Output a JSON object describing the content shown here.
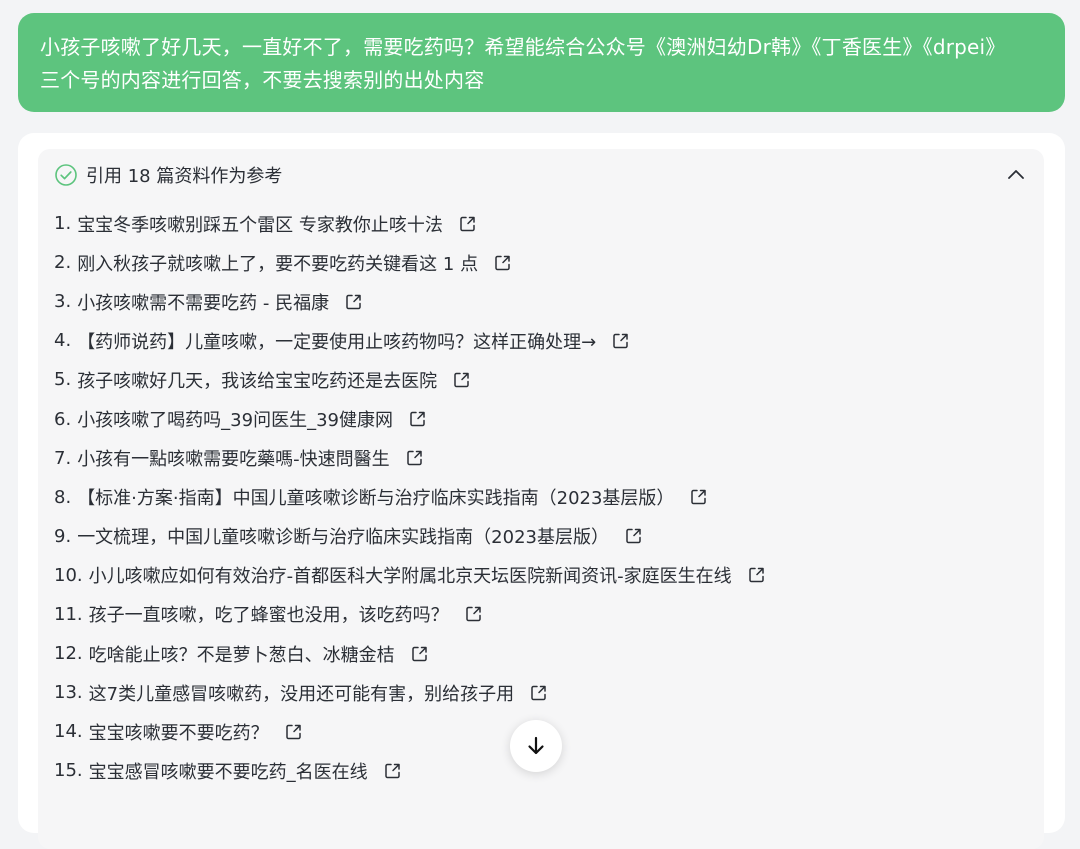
{
  "user_message": {
    "line1": "小孩子咳嗽了好几天，一直好不了，需要吃药吗？希望能综合公众号《澳洲妇幼Dr韩》《丁香医生》《drpei》",
    "line2": "三个号的内容进行回答，不要去搜索别的出处内容"
  },
  "references": {
    "title": "引用 18 篇资料作为参考",
    "check_icon": "check-circle-icon",
    "collapse_icon": "chevron-up-icon",
    "link_icon": "external-link-icon",
    "items": [
      {
        "num": "1.",
        "title": "宝宝冬季咳嗽别踩五个雷区 专家教你止咳十法"
      },
      {
        "num": "2.",
        "title": "刚入秋孩子就咳嗽上了，要不要吃药关键看这 1 点"
      },
      {
        "num": "3.",
        "title": "小孩咳嗽需不需要吃药 - 民福康"
      },
      {
        "num": "4.",
        "title": "【药师说药】儿童咳嗽，一定要使用止咳药物吗？这样正确处理→"
      },
      {
        "num": "5.",
        "title": "孩子咳嗽好几天，我该给宝宝吃药还是去医院"
      },
      {
        "num": "6.",
        "title": "小孩咳嗽了喝药吗_39问医生_39健康网"
      },
      {
        "num": "7.",
        "title": "小孩有一點咳嗽需要吃藥嗎-快速問醫生"
      },
      {
        "num": "8.",
        "title": "【标准·方案·指南】中国儿童咳嗽诊断与治疗临床实践指南（2023基层版）"
      },
      {
        "num": "9.",
        "title": "一文梳理，中国儿童咳嗽诊断与治疗临床实践指南（2023基层版）"
      },
      {
        "num": "10.",
        "title": "小儿咳嗽应如何有效治疗-首都医科大学附属北京天坛医院新闻资讯-家庭医生在线"
      },
      {
        "num": "11.",
        "title": "孩子一直咳嗽，吃了蜂蜜也没用，该吃药吗？"
      },
      {
        "num": "12.",
        "title": "吃啥能止咳？不是萝卜葱白、冰糖金桔"
      },
      {
        "num": "13.",
        "title": "这7类儿童感冒咳嗽药，没用还可能有害，别给孩子用"
      },
      {
        "num": "14.",
        "title": "宝宝咳嗽要不要吃药？"
      },
      {
        "num": "15.",
        "title": "宝宝感冒咳嗽要不要吃药_名医在线"
      }
    ]
  },
  "scroll_button": {
    "icon": "arrow-down-icon"
  },
  "colors": {
    "user_bubble": "#5dc47e",
    "panel": "#f6f6f7",
    "text": "#2b2f36",
    "check": "#5dc47e"
  }
}
